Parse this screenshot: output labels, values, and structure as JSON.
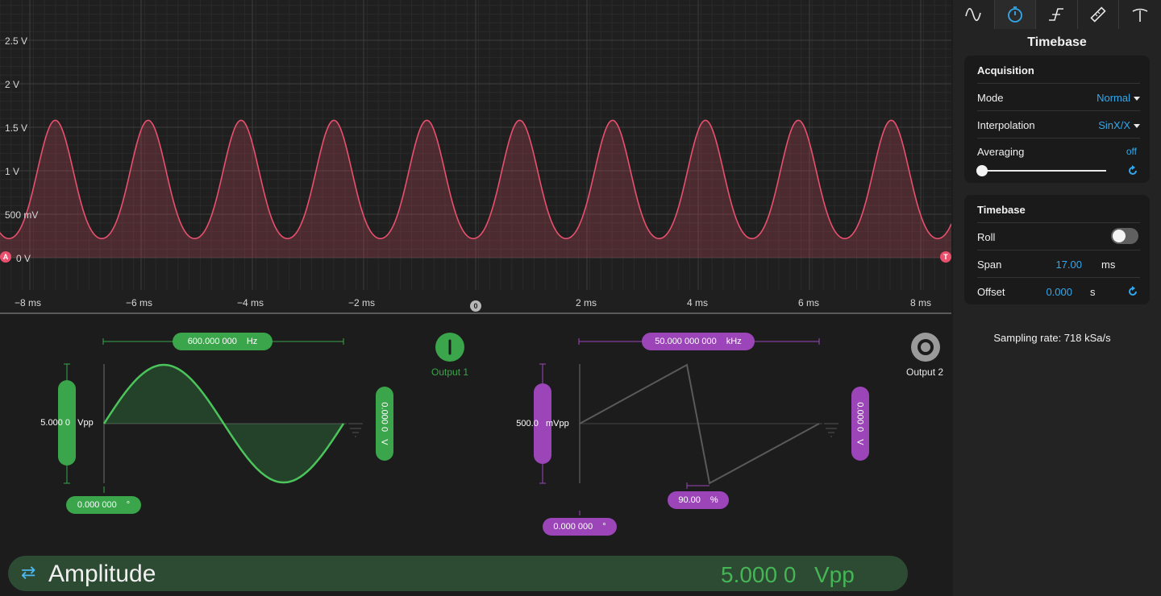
{
  "scope": {
    "y_ticks": [
      "2.5 V",
      "2 V",
      "1.5 V",
      "1 V",
      "500 mV",
      "0 V"
    ],
    "x_ticks": [
      "−8 ms",
      "−6 ms",
      "−4 ms",
      "−2 ms",
      "2 ms",
      "4 ms",
      "6 ms",
      "8 ms"
    ],
    "channel_marker": "A",
    "trigger_marker": "T",
    "time_zero_marker": "0",
    "trace_color": "#e8506e"
  },
  "output1": {
    "label": "Output 1",
    "frequency_value": "600.000 000",
    "frequency_unit": "Hz",
    "amplitude_value": "5.000 0",
    "amplitude_unit": "Vpp",
    "offset_value": "0.000 0",
    "offset_unit": "V",
    "phase_value": "0.000 000",
    "phase_unit": "°",
    "waveform": "sine",
    "enabled": true,
    "color": "#3aa54a"
  },
  "output2": {
    "label": "Output 2",
    "frequency_value": "50.000 000 000",
    "frequency_unit": "kHz",
    "amplitude_value": "500.0",
    "amplitude_unit": "mVpp",
    "offset_value": "0.000 0",
    "offset_unit": "V",
    "symmetry_value": "90.00",
    "symmetry_unit": "%",
    "phase_value": "0.000 000",
    "phase_unit": "°",
    "waveform": "ramp",
    "enabled": false,
    "color": "#9b45b8"
  },
  "amplitude_bar": {
    "label": "Amplitude",
    "value": "5.000 0",
    "unit": "Vpp"
  },
  "panel": {
    "tabs": [
      "waveform-icon",
      "stopwatch-icon",
      "trigger-edge-icon",
      "ruler-icon",
      "probe-icon"
    ],
    "active_tab": "stopwatch-icon",
    "title": "Timebase",
    "acquisition": {
      "header": "Acquisition",
      "mode_label": "Mode",
      "mode_value": "Normal",
      "interpolation_label": "Interpolation",
      "interpolation_value": "SinX/X",
      "averaging_label": "Averaging",
      "averaging_value": "off"
    },
    "timebase": {
      "header": "Timebase",
      "roll_label": "Roll",
      "roll_on": false,
      "span_label": "Span",
      "span_value": "17.00",
      "span_unit": "ms",
      "offset_label": "Offset",
      "offset_value": "0.000",
      "offset_unit": "s"
    },
    "sampling_rate": "Sampling rate: 718 kSa/s"
  }
}
